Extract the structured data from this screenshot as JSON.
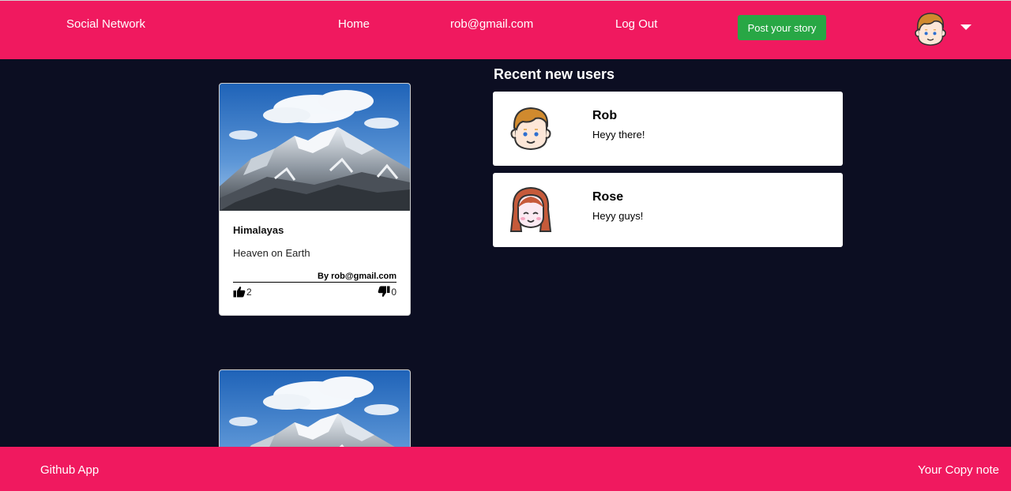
{
  "navbar": {
    "brand": "Social Network",
    "home": "Home",
    "user_email": "rob@gmail.com",
    "logout": "Log Out",
    "post_button": "Post your story",
    "avatar_icon": "boy-avatar-icon",
    "dropdown_icon": "caret-down-icon"
  },
  "posts": [
    {
      "image_icon": "mountain-photo",
      "title": "Himalayas",
      "description": "Heaven on Earth",
      "author": "By rob@gmail.com",
      "likes": "2",
      "dislikes": "0"
    },
    {
      "image_icon": "mountain-photo"
    }
  ],
  "recent_users": {
    "title": "Recent new users",
    "users": [
      {
        "name": "Rob",
        "status": "Heyy there!",
        "avatar_icon": "boy-avatar-icon"
      },
      {
        "name": "Rose",
        "status": "Heyy guys!",
        "avatar_icon": "girl-avatar-icon"
      }
    ]
  },
  "footer": {
    "left": "Github App",
    "right": "Your Copy note"
  },
  "colors": {
    "accent": "#f0195f",
    "background": "#0c0e22",
    "button": "#28a745"
  }
}
